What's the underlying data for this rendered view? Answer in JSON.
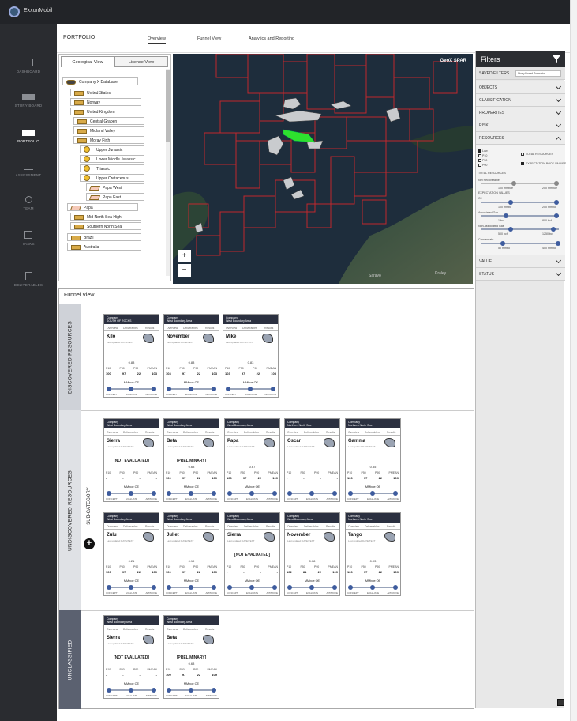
{
  "app": {
    "brand": "ExxonMobil"
  },
  "nav": [
    "DASHBOARD",
    "STORY BOARD",
    "PORTFOLIO",
    "ASSESSMENT",
    "TEAM",
    "TASKS",
    "DELIVERABLES"
  ],
  "header": {
    "title": "PORTFOLIO",
    "tabs": [
      "Overview",
      "Funnel View",
      "Analytics and Reporting"
    ]
  },
  "tree": {
    "tabs": [
      "Geological View",
      "License View"
    ],
    "nodes": [
      "Company X Database",
      "United States",
      "Norway",
      "United Kingdom",
      "Central Graben",
      "Midland Valley",
      "Moray Firth",
      "Upper Jurassic",
      "Lower Middle Jurassic",
      "Triassic",
      "Upper Cretaceous",
      "Papa West",
      "Papa East",
      "Papa",
      "Mid North Sea High",
      "Southern North Sea",
      "Brazil",
      "Australia"
    ]
  },
  "map": {
    "title": "GeoX SPAR",
    "zoom_in": "+",
    "zoom_out": "−",
    "places": [
      "Sarayo",
      "Kraley"
    ]
  },
  "filters": {
    "title": "Filters",
    "saved_label": "SAVED FILTERS",
    "saved_value": "Story Board Scenario",
    "sections": [
      "OBJECTS",
      "CLASSIFICATION",
      "PROPERTIES",
      "RISK",
      "RESOURCES",
      "VALUE",
      "STATUS"
    ],
    "resources": {
      "checks": [
        "Low",
        "P10",
        "P50",
        "P90"
      ],
      "checks2": [
        "TOTAL RESOURCES",
        "EXPECTATION BOOK VALUES"
      ],
      "total_label": "TOTAL RESOURCES",
      "recov_label": "Net Recoverable",
      "recov_min": "100",
      "recov_max": "200",
      "recov_min_unit": "mmboe",
      "recov_max_unit": "mmboe",
      "exp_label": "EXPECTATION VALUES",
      "oil_label": "Oil",
      "oil_min": "100",
      "oil_max": "250",
      "oil_min_unit": "mmbo",
      "oil_max_unit": "mmbo",
      "assoc_label": "Associated Gas",
      "assoc_min": "1",
      "assoc_max": "800",
      "assoc_min_unit": "bcf",
      "assoc_max_unit": "bcf",
      "nonassoc_label": "Non-associated Gas",
      "nonassoc_min": "500",
      "nonassoc_max": "1250",
      "nonassoc_min_unit": "bcf",
      "nonassoc_max_unit": "bcf",
      "cond_label": "Condensate",
      "cond_min": "50",
      "cond_max": "400",
      "cond_min_unit": "mmbo",
      "cond_max_unit": "mmbo"
    }
  },
  "funnel": {
    "title": "Funnel View",
    "bands": [
      "DISCOVERED RESOURCES",
      "UNDISCOVERED RESOURCES",
      "UNCLASSIFIED"
    ],
    "subcategory": "SUB-CATEGORY",
    "card_tabs": [
      "Overview",
      "Deliverables",
      "Results"
    ],
    "card_cols": [
      "P10",
      "P50",
      "P90",
      "PMEAN"
    ],
    "card_foot": [
      "CONCEPT",
      "EVALUATE",
      "APPROVE"
    ],
    "cards": [
      {
        "name": "Kilo",
        "sub": "Last updated DATE/TEXT",
        "head": "Company",
        "head2": "SOUTH OF ROCKS",
        "ne": "0.83",
        "p": [
          "100",
          "97",
          "22",
          "103"
        ],
        "unit": "MMboe OE"
      },
      {
        "name": "November",
        "sub": "Last updated DATE/TEXT",
        "head": "Company",
        "head2": "West Boundary Area",
        "ne": "0.83",
        "p": [
          "103",
          "97",
          "22",
          "103"
        ],
        "unit": "MMboe OE"
      },
      {
        "name": "Mike",
        "sub": "Last updated DATE/TEXT",
        "head": "Company",
        "head2": "West Boundary Area",
        "ne": "0.83",
        "p": [
          "103",
          "97",
          "22",
          "103"
        ],
        "unit": "MMboe OE"
      },
      {
        "name": "Sierra",
        "sub": "Last updated DATE/TEXT",
        "head": "Company",
        "head2": "West Boundary Area",
        "ne": "",
        "status": "[NOT EVALUATED]",
        "p": [
          "-",
          "-",
          "-",
          "-"
        ],
        "unit": "MMboe OE"
      },
      {
        "name": "Beta",
        "sub": "Last updated DATE/TEXT",
        "head": "Company",
        "head2": "West Boundary Area",
        "ne": "0.63",
        "status": "[PRELIMINARY]",
        "p": [
          "100",
          "97",
          "22",
          "109"
        ],
        "unit": "MMboe OE"
      },
      {
        "name": "Papa",
        "sub": "Last updated DATE/TEXT",
        "head": "Company",
        "head2": "West Boundary Area",
        "ne": "0.67",
        "p": [
          "100",
          "97",
          "22",
          "109"
        ],
        "unit": "MMboe OE"
      },
      {
        "name": "Oscar",
        "sub": "Last updated DATE/TEXT",
        "head": "Company",
        "head2": "Northern North Sea",
        "ne": "",
        "p": [
          "-",
          "-",
          "-",
          "-"
        ],
        "unit": ""
      },
      {
        "name": "Gamma",
        "sub": "Last updated DATE/TEXT",
        "head": "Company",
        "head2": "Northern North Sea",
        "ne": "0.85",
        "p": [
          "100",
          "97",
          "22",
          "109"
        ],
        "unit": "MMboe OE"
      },
      {
        "name": "Zulu",
        "sub": "Last updated DATE/TEXT",
        "head": "Company",
        "head2": "West Boundary Area",
        "ne": "0.21",
        "p": [
          "100",
          "97",
          "22",
          "109"
        ],
        "unit": "MMboe OE"
      },
      {
        "name": "Juliet",
        "sub": "Last updated DATE/TEXT",
        "head": "Company",
        "head2": "West Boundary Area",
        "ne": "0.19",
        "p": [
          "100",
          "97",
          "22",
          "109"
        ],
        "unit": "MMboe OE"
      },
      {
        "name": "Sierra",
        "sub": "Last updated DATE/TEXT",
        "head": "Company",
        "head2": "West Boundary Area",
        "ne": "",
        "status": "[NOT EVALUATED]",
        "p": [
          "-",
          "-",
          "-",
          "-"
        ],
        "unit": "MMboe OE"
      },
      {
        "name": "November",
        "sub": "Last updated DATE/TEXT",
        "head": "Company",
        "head2": "West Boundary Area",
        "ne": "0.08",
        "p": [
          "102",
          "81",
          "22",
          "109"
        ],
        "unit": "MMboe OE"
      },
      {
        "name": "Tango",
        "sub": "Last updated DATE/TEXT",
        "head": "Company",
        "head2": "Northern North Sea",
        "ne": "0.03",
        "p": [
          "100",
          "97",
          "22",
          "109"
        ],
        "unit": "MMboe OE"
      },
      {
        "name": "Sierra",
        "sub": "Last updated DATE/TEXT",
        "head": "Company",
        "head2": "West Boundary Area",
        "ne": "",
        "status": "[NOT EVALUATED]",
        "p": [
          "-",
          "-",
          "-",
          "-"
        ],
        "unit": "MMboe OE"
      },
      {
        "name": "Beta",
        "sub": "Last updated DATE/TEXT",
        "head": "Company",
        "head2": "West Boundary Area",
        "ne": "0.63",
        "status": "[PRELIMINARY]",
        "p": [
          "100",
          "97",
          "22",
          "109"
        ],
        "unit": "MMboe OE"
      }
    ]
  }
}
